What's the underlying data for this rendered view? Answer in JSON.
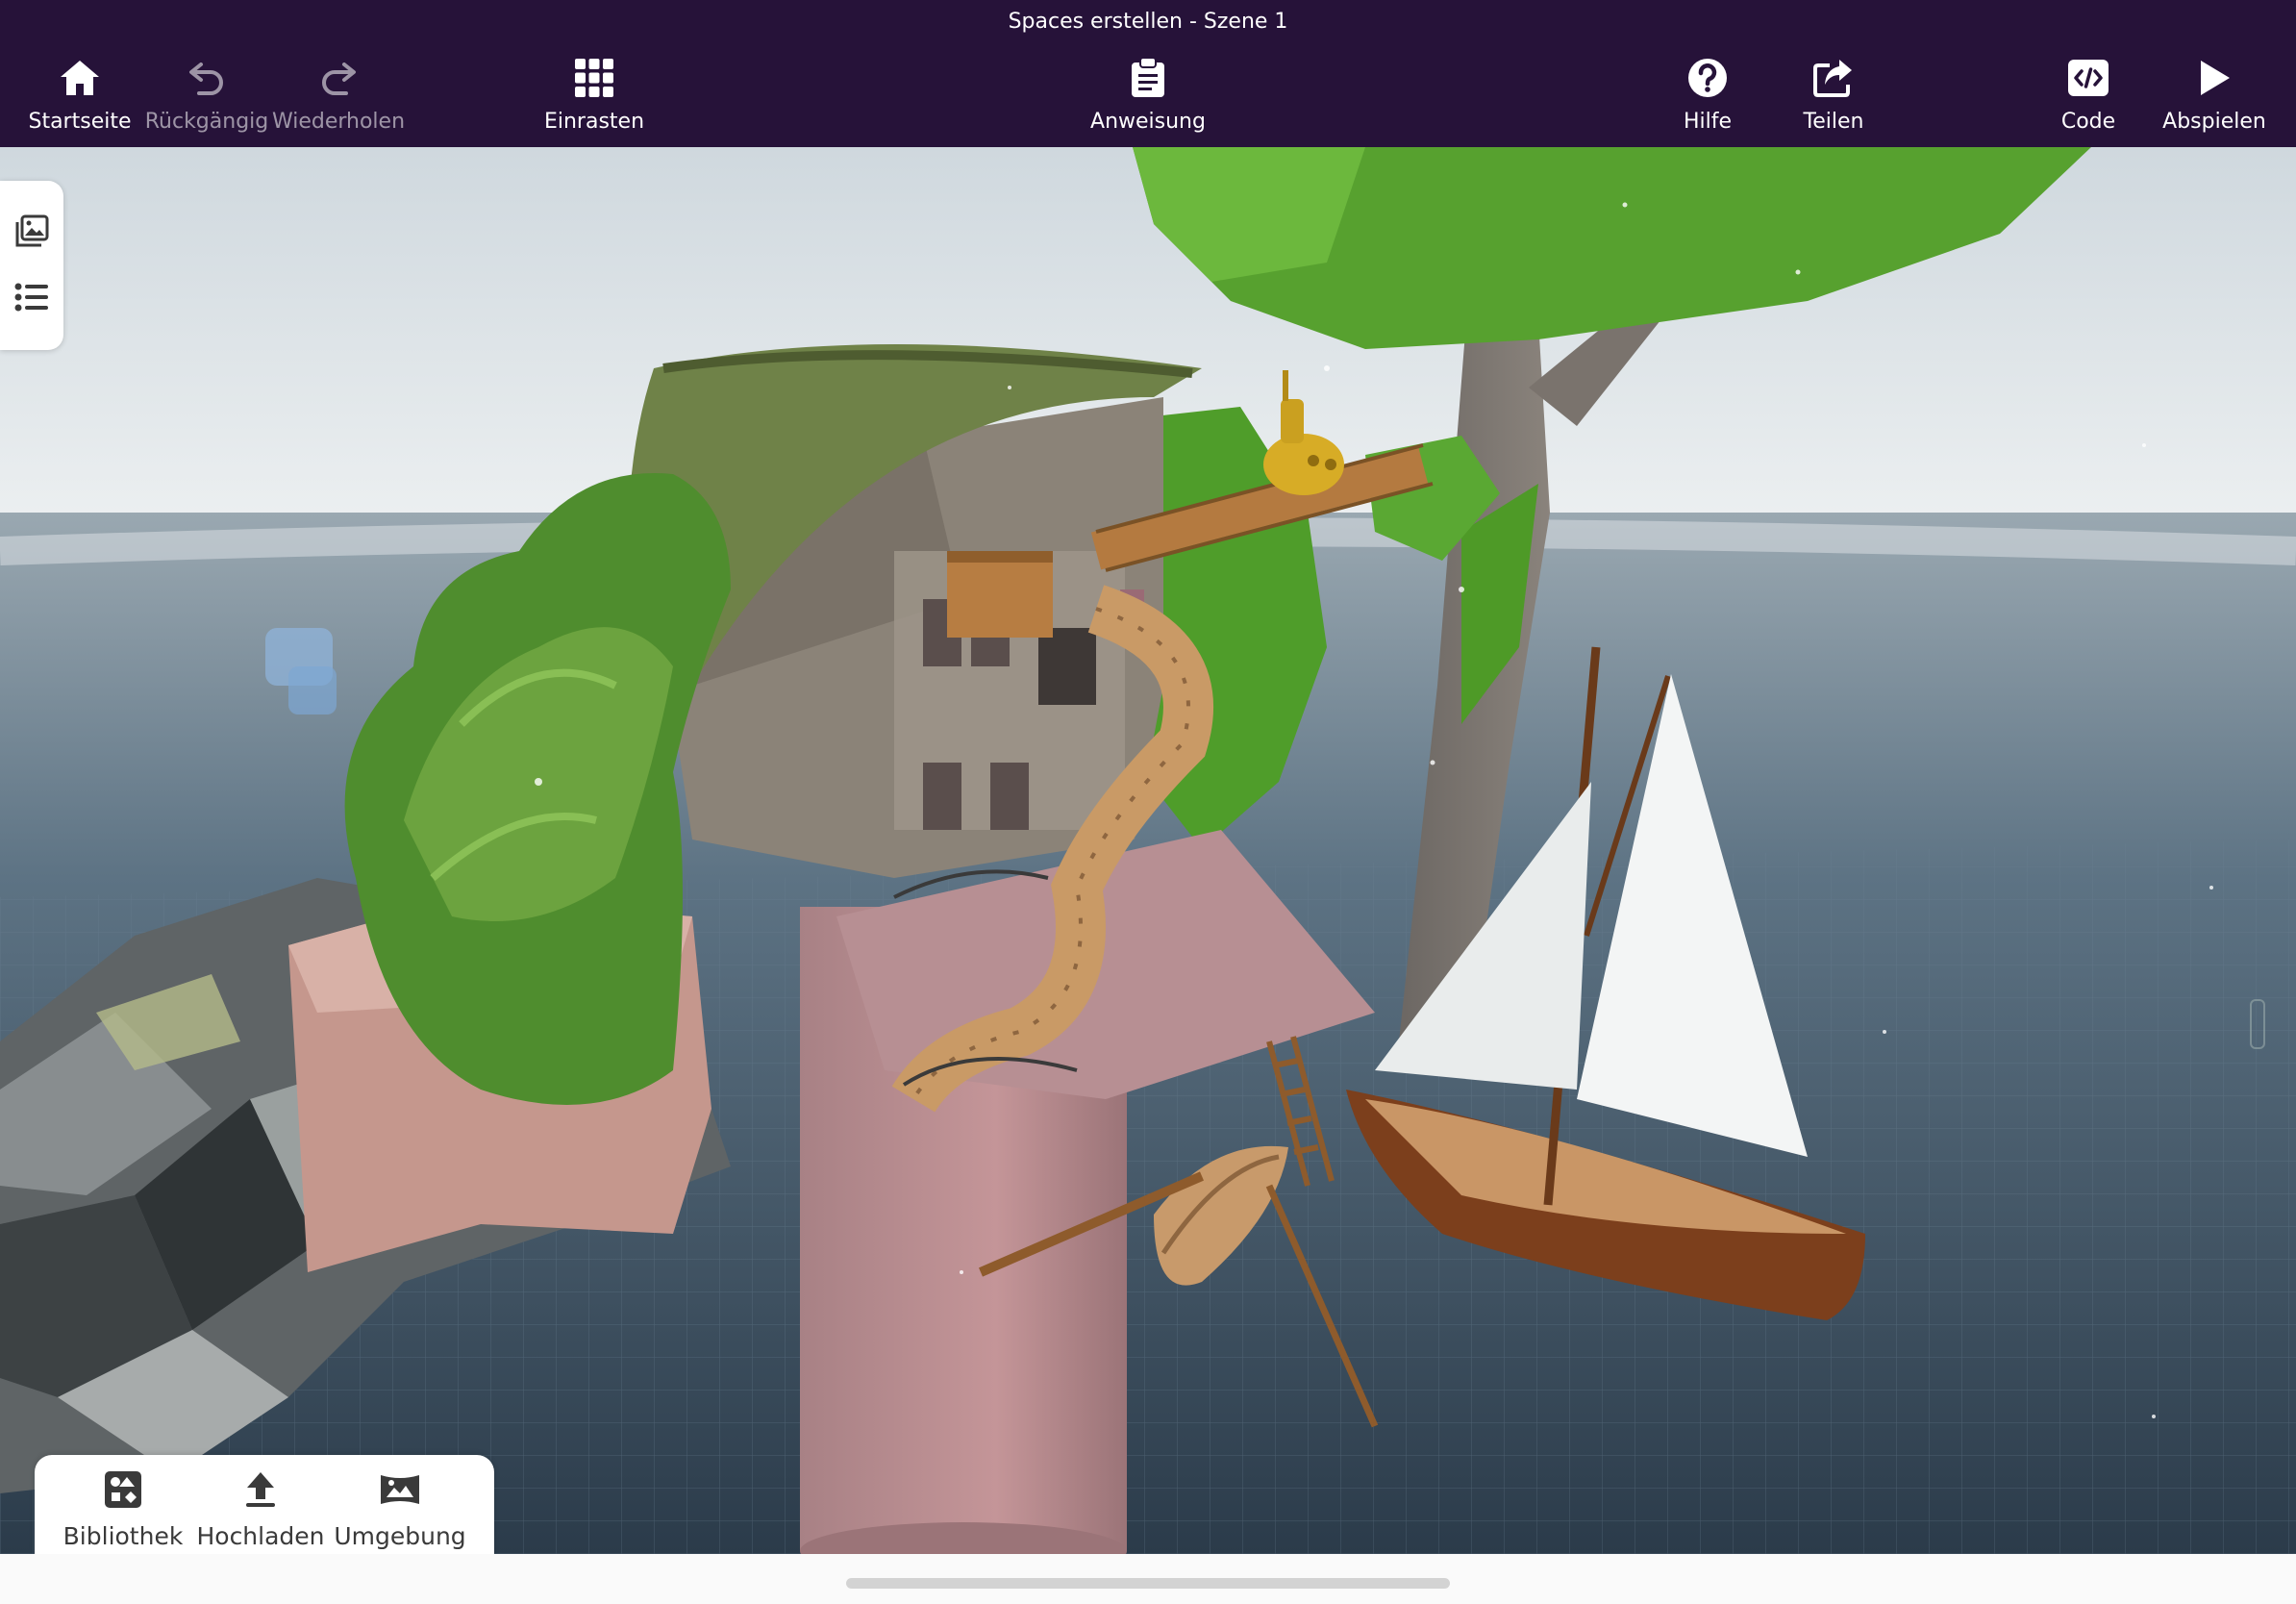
{
  "window": {
    "title": "Spaces erstellen - Szene 1"
  },
  "toolbar": {
    "home": {
      "label": "Startseite",
      "icon": "home-icon"
    },
    "undo": {
      "label": "Rückgängig",
      "icon": "undo-icon",
      "enabled": false
    },
    "redo": {
      "label": "Wiederholen",
      "icon": "redo-icon",
      "enabled": false
    },
    "snap": {
      "label": "Einrasten",
      "icon": "grid-icon"
    },
    "instruction": {
      "label": "Anweisung",
      "icon": "clipboard-icon"
    },
    "help": {
      "label": "Hilfe",
      "icon": "help-icon"
    },
    "share": {
      "label": "Teilen",
      "icon": "share-icon"
    },
    "code": {
      "label": "Code",
      "icon": "code-icon"
    },
    "play": {
      "label": "Abspielen",
      "icon": "play-icon"
    }
  },
  "sidebar": {
    "items": [
      {
        "icon": "gallery-icon"
      },
      {
        "icon": "list-icon"
      }
    ]
  },
  "bottom_panel": {
    "library": {
      "label": "Bibliothek",
      "icon": "library-icon"
    },
    "upload": {
      "label": "Hochladen",
      "icon": "upload-icon"
    },
    "environment": {
      "label": "Umgebung",
      "icon": "environment-icon"
    }
  },
  "colors": {
    "toolbar_bg": "#261239",
    "panel_bg": "#ffffff",
    "icon_gray": "#3a3a3a"
  }
}
